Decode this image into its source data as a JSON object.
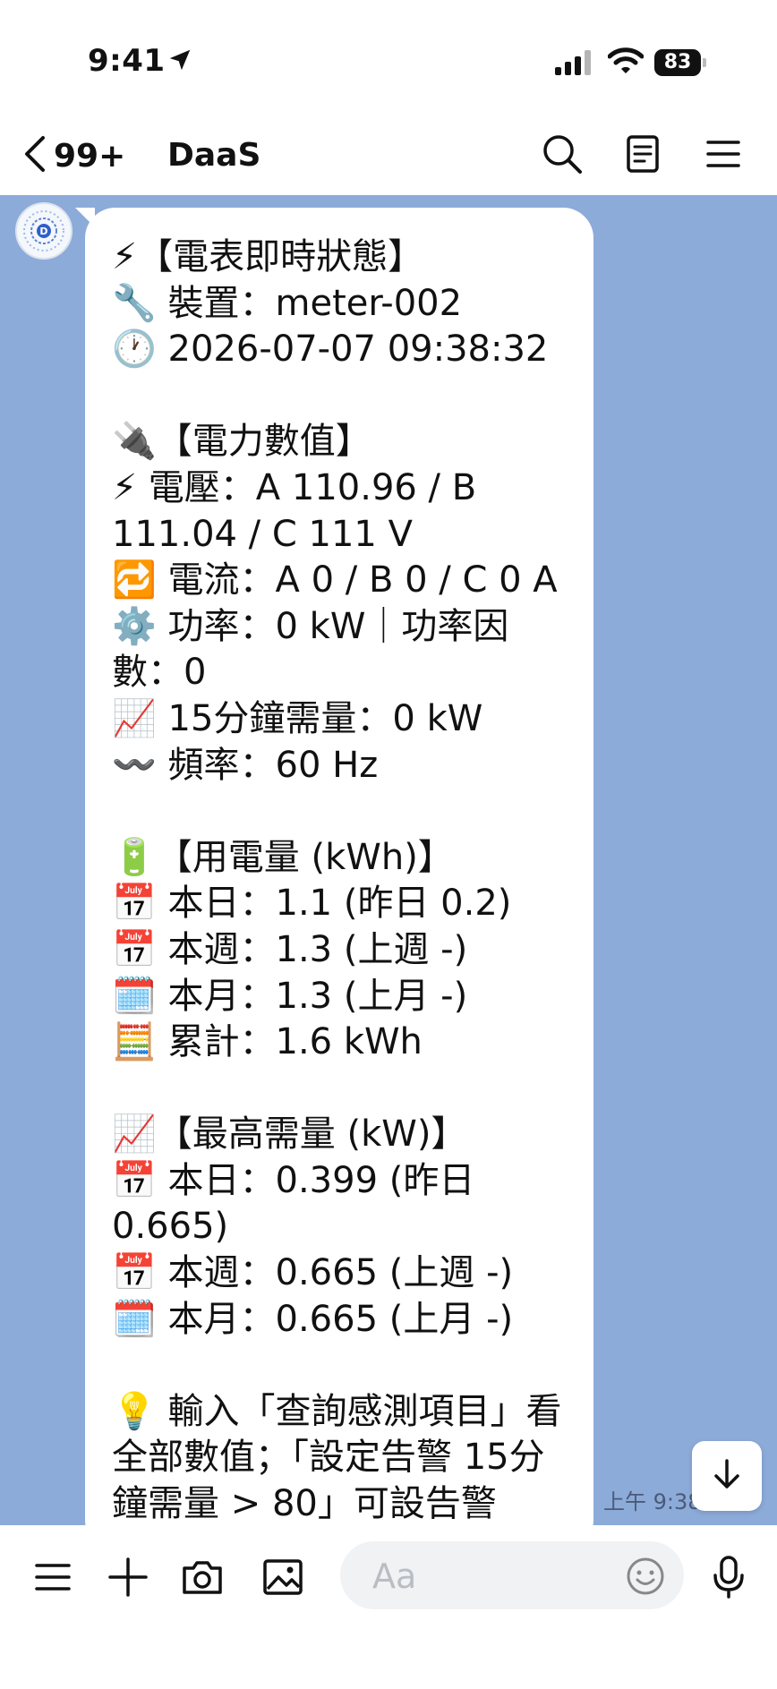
{
  "status_bar": {
    "time": "9:41",
    "battery": "83"
  },
  "navbar": {
    "back_count": "99+",
    "title": "DaaS"
  },
  "message": {
    "lines": [
      "⚡【電表即時狀態】",
      "🔧 裝置：meter-002",
      "🕐 2026-07-07 09:38:32",
      "",
      "🔌【電力數值】",
      "⚡ 電壓：A 110.96 / B",
      "111.04 / C 111 V",
      "🔁 電流：A 0 / B 0 / C 0 A",
      "⚙️ 功率：0 kW｜功率因",
      "數：0",
      "📈 15分鐘需量：0 kW",
      "〰️ 頻率：60 Hz",
      "",
      "🔋【用電量 (kWh)】",
      "📅 本日：1.1 (昨日 0.2)",
      "📅 本週：1.3 (上週 -)",
      "🗓️ 本月：1.3 (上月 -)",
      "🧮 累計：1.6 kWh",
      "",
      "📈【最高需量 (kW)】",
      "📅 本日：0.399 (昨日",
      "0.665)",
      "📅 本週：0.665 (上週 -)",
      "🗓️ 本月：0.665 (上月 -)",
      "",
      "💡 輸入「查詢感測項目」看",
      "全部數值；「設定告警 15分",
      "鐘需量 > 80」可設告警"
    ],
    "time": "上午 9:38"
  },
  "input_bar": {
    "placeholder": "Aa"
  },
  "colors": {
    "chat_background": "#8dabd9",
    "bubble": "#ffffff",
    "input_field": "#f1f2f4"
  }
}
